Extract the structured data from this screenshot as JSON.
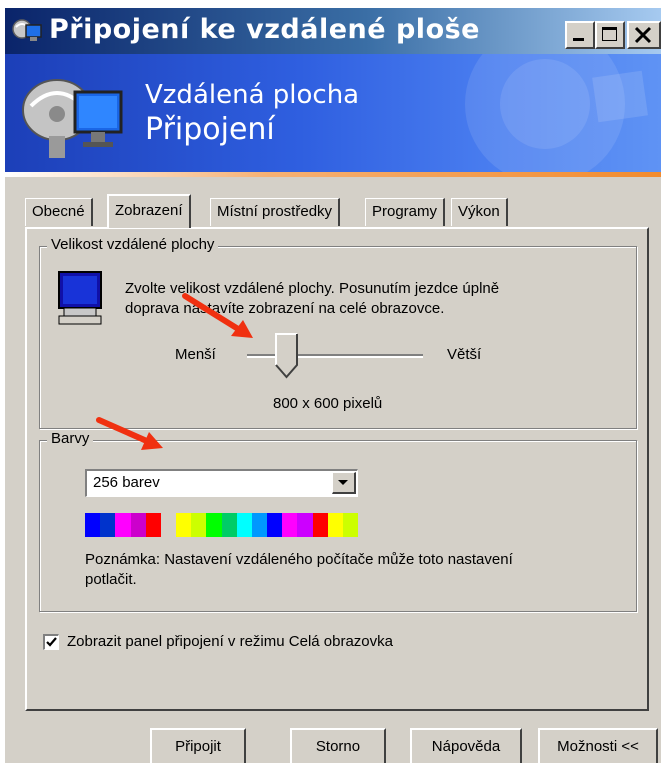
{
  "window": {
    "title": "Připojení ke vzdálené ploše",
    "controls": [
      "minimize-icon",
      "maximize-icon",
      "close-icon"
    ]
  },
  "banner": {
    "line1": "Vzdálená plocha",
    "line2": "Připojení"
  },
  "tabs": [
    {
      "label": "Obecné",
      "active": false
    },
    {
      "label": "Zobrazení",
      "active": true
    },
    {
      "label": "Místní prostředky",
      "active": false
    },
    {
      "label": "Programy",
      "active": false
    },
    {
      "label": "Výkon",
      "active": false
    }
  ],
  "display_size": {
    "group_title": "Velikost vzdálené plochy",
    "description_line1": "Zvolte velikost vzdálené plochy. Posunutím jezdce úplně",
    "description_line2": "doprava nastavíte zobrazení na celé obrazovce.",
    "slider_min_label": "Menší",
    "slider_max_label": "Větší",
    "slider_position": 0.25,
    "resolution_text": "800 x 600 pixelů"
  },
  "colors": {
    "group_title": "Barvy",
    "selected_option": "256 barev",
    "swatches": [
      "#0000ff",
      "#0033cc",
      "#ff00ff",
      "#cc00cc",
      "#ff0000",
      "#d4d0c8",
      "#ffff00",
      "#ccff00",
      "#00ff00",
      "#00cc66",
      "#00ffff",
      "#0099ff",
      "#0000ff",
      "#ff00ff",
      "#cc00ff",
      "#ff0000",
      "#ffff00",
      "#ccff00"
    ],
    "note_line1": "Poznámka: Nastavení vzdáleného počítače může toto nastavení",
    "note_line2": "potlačit."
  },
  "fullscreen_bar": {
    "label": "Zobrazit panel připojení v režimu Celá obrazovka",
    "checked": true
  },
  "buttons": {
    "connect": "Připojit",
    "cancel": "Storno",
    "help": "Nápověda",
    "options": "Možnosti <<"
  },
  "accent": {
    "title_bar": "#0a246a",
    "banner": "#2f5fe0",
    "annotation_arrow": "#f03010"
  }
}
